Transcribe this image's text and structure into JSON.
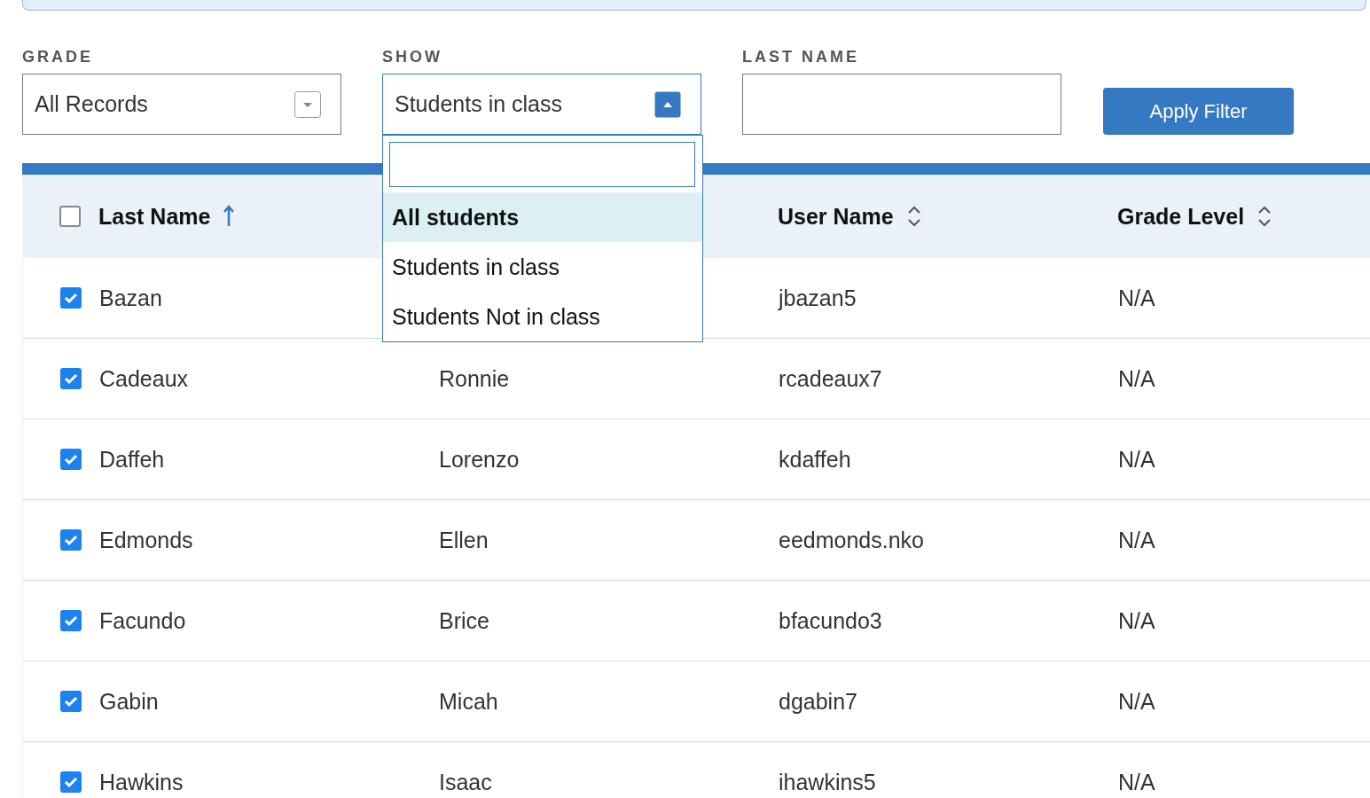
{
  "filters": [
    {
      "kind": "select",
      "label": "GRADE",
      "value": "All Records",
      "open": false
    },
    {
      "kind": "select",
      "label": "SHOW",
      "value": "Students in class",
      "open": true
    },
    {
      "kind": "text",
      "label": "LAST NAME"
    }
  ],
  "apply_button": "Apply Filter",
  "dropdown": {
    "options": [
      {
        "label": "All students",
        "highlighted": true
      },
      {
        "label": "Students in class",
        "highlighted": false
      },
      {
        "label": "Students Not in class",
        "highlighted": false
      }
    ]
  },
  "table": {
    "select_all_checked": false,
    "columns": [
      {
        "label": "Last Name",
        "sorted": true
      },
      {
        "label": "User Name",
        "sorted": false
      },
      {
        "label": "Grade Level",
        "sorted": false
      }
    ],
    "rows": [
      {
        "checked": true,
        "last_name": "Bazan",
        "user_name": "jbazan5",
        "grade_level": "N/A"
      },
      {
        "checked": true,
        "last_name": "Cadeaux",
        "column_2": "Ronnie",
        "user_name": "rcadeaux7",
        "grade_level": "N/A"
      },
      {
        "checked": true,
        "last_name": "Daffeh",
        "column_2": "Lorenzo",
        "user_name": "kdaffeh",
        "grade_level": "N/A"
      },
      {
        "checked": true,
        "last_name": "Edmonds",
        "column_2": "Ellen",
        "user_name": "eedmonds.nko",
        "grade_level": "N/A"
      },
      {
        "checked": true,
        "last_name": "Facundo",
        "column_2": "Brice",
        "user_name": "bfacundo3",
        "grade_level": "N/A"
      },
      {
        "checked": true,
        "last_name": "Gabin",
        "column_2": "Micah",
        "user_name": "dgabin7",
        "grade_level": "N/A"
      },
      {
        "checked": true,
        "last_name": "Hawkins",
        "column_2": "Isaac",
        "user_name": "ihawkins5",
        "grade_level": "N/A"
      }
    ]
  }
}
